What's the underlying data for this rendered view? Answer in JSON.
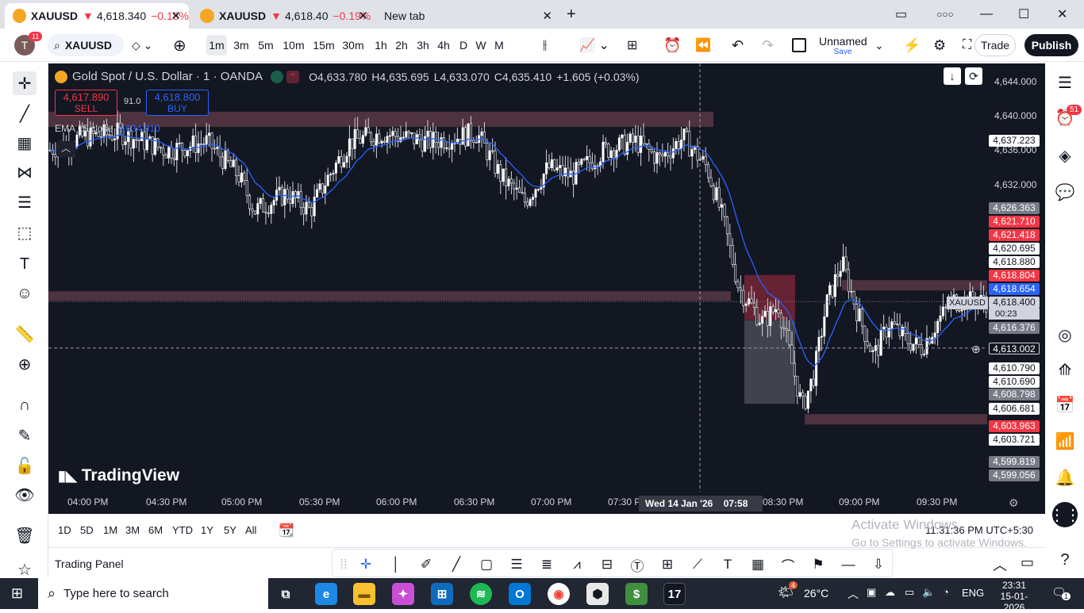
{
  "browser": {
    "tabs": [
      {
        "symbol": "XAUUSD",
        "arrow": "▼",
        "price": "4,618.340",
        "change": "−0.18%"
      },
      {
        "symbol": "XAUUSD",
        "arrow": "▼",
        "price": "4,618.40",
        "change": "−0.19%"
      },
      {
        "title": "New tab"
      }
    ],
    "close_glyph": "✕",
    "new_tab_glyph": "+"
  },
  "toolbar": {
    "avatar_letter": "T",
    "notif_count": "11",
    "symbol": "XAUUSD",
    "timeframes": [
      "1m",
      "3m",
      "5m",
      "10m",
      "15m",
      "30m",
      "1h",
      "2h",
      "3h",
      "4h",
      "D",
      "W",
      "M"
    ],
    "selected_timeframe": "1m",
    "layout_name": "Unnamed",
    "layout_save": "Save",
    "trade_label": "Trade",
    "publish_label": "Publish"
  },
  "chart": {
    "title": "Gold Spot / U.S. Dollar · 1 · OANDA",
    "o_label": "O",
    "o": "4,633.780",
    "h_label": "H",
    "h": "4,635.695",
    "l_label": "L",
    "l": "4,633.070",
    "c_label": "C",
    "c": "4,635.410",
    "change": "+1.605 (+0.03%)",
    "sell_price": "4,617.890",
    "sell_label": "SELL",
    "buy_price": "4,618.800",
    "buy_label": "BUY",
    "spread": "91.0",
    "ema_label": "EMA 15 close",
    "ema_value": "4,634.910",
    "branding": "TradingView",
    "crosshair_date": "Wed 14 Jan '26",
    "crosshair_time": "07:58 PM",
    "symbol_tag": "XAUUSD",
    "countdown": "00:23",
    "time_labels": [
      "04:00 PM",
      "04:30 PM",
      "05:00 PM",
      "05:30 PM",
      "06:00 PM",
      "06:30 PM",
      "07:00 PM",
      "07:30 PM",
      "08:30 PM",
      "09:00 PM",
      "09:30 PM"
    ],
    "axis_prices": [
      "4,644.000",
      "4,640.000",
      "4,636.000",
      "4,632.000"
    ],
    "price_labels": [
      {
        "v": "4,637.223",
        "style": "white"
      },
      {
        "v": "4,626.363",
        "style": "gray"
      },
      {
        "v": "4,621.710",
        "style": "red"
      },
      {
        "v": "4,621.418",
        "style": "red"
      },
      {
        "v": "4,620.695",
        "style": "white"
      },
      {
        "v": "4,618.880",
        "style": "white"
      },
      {
        "v": "4,618.804",
        "style": "red"
      },
      {
        "v": "4,618.654",
        "style": "blue"
      },
      {
        "v": "4,618.400",
        "style": "light"
      },
      {
        "v": "4,616.376",
        "style": "gray"
      },
      {
        "v": "4,613.002",
        "style": "dark"
      },
      {
        "v": "4,610.790",
        "style": "white"
      },
      {
        "v": "4,610.690",
        "style": "white"
      },
      {
        "v": "4,608.798",
        "style": "gray"
      },
      {
        "v": "4,606.681",
        "style": "white"
      },
      {
        "v": "4,603.963",
        "style": "red"
      },
      {
        "v": "4,603.721",
        "style": "white"
      },
      {
        "v": "4,599.819",
        "style": "gray"
      },
      {
        "v": "4,599.056",
        "style": "gray"
      }
    ]
  },
  "bottom": {
    "ranges": [
      "1D",
      "5D",
      "1M",
      "3M",
      "6M",
      "YTD",
      "1Y",
      "5Y",
      "All"
    ],
    "clock": "11:31:36 PM",
    "tz": "UTC+5:30",
    "trading_panel": "Trading Panel"
  },
  "watermark": {
    "line1": "Activate Windows",
    "line2": "Go to Settings to activate Windows."
  },
  "right_sidebar": {
    "badge": "51"
  },
  "taskbar": {
    "search_placeholder": "Type here to search",
    "weather": "26°C",
    "weather_badge": "4",
    "lang": "ENG",
    "time": "23:31",
    "date": "15-01-2026",
    "notif": "1"
  }
}
